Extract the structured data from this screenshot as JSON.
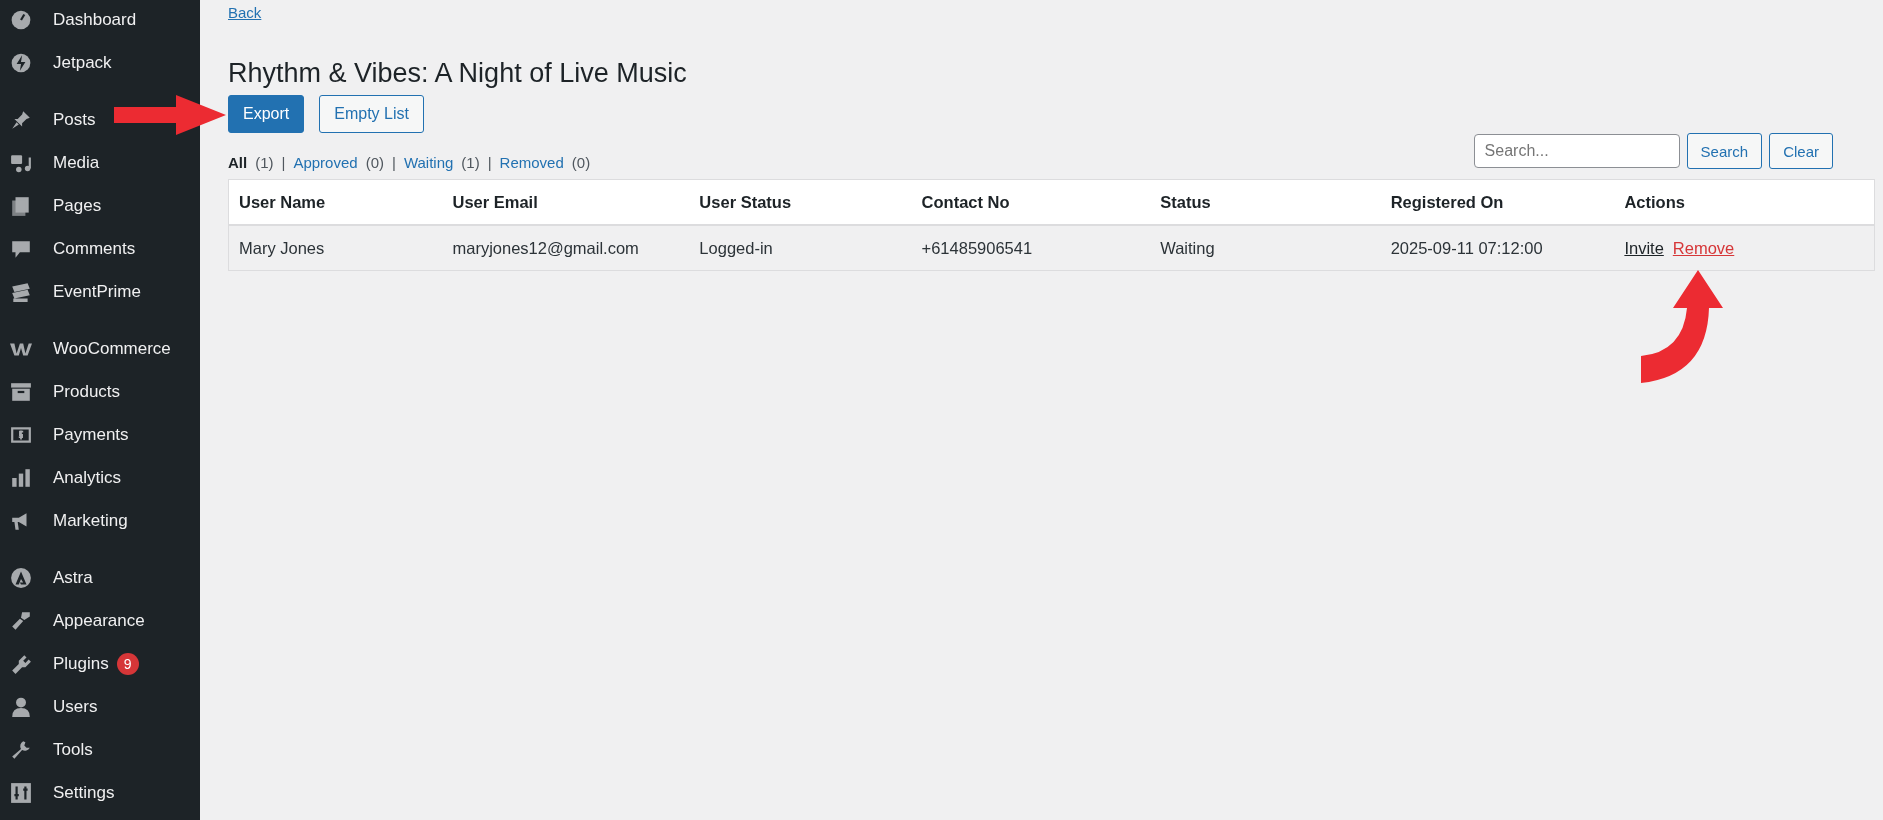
{
  "sidebar": {
    "groups": [
      [
        {
          "label": "Dashboard"
        },
        {
          "label": "Jetpack"
        }
      ],
      [
        {
          "label": "Posts"
        },
        {
          "label": "Media"
        },
        {
          "label": "Pages"
        },
        {
          "label": "Comments"
        },
        {
          "label": "EventPrime"
        }
      ],
      [
        {
          "label": "WooCommerce"
        },
        {
          "label": "Products"
        },
        {
          "label": "Payments"
        },
        {
          "label": "Analytics"
        },
        {
          "label": "Marketing"
        }
      ],
      [
        {
          "label": "Astra"
        },
        {
          "label": "Appearance"
        },
        {
          "label": "Plugins",
          "badge": "9"
        },
        {
          "label": "Users"
        },
        {
          "label": "Tools"
        },
        {
          "label": "Settings"
        }
      ]
    ]
  },
  "back_link": "Back",
  "title": "Rhythm & Vibes: A Night of Live Music",
  "buttons": [
    {
      "label": "Export",
      "kind": "primary"
    },
    {
      "label": "Empty List",
      "kind": "secondary"
    }
  ],
  "filter_separator": "|",
  "filters": [
    {
      "label": "All",
      "count": "(1)",
      "selected": true
    },
    {
      "label": "Approved",
      "count": "(0)",
      "selected": false
    },
    {
      "label": "Waiting",
      "count": "(1)",
      "selected": false
    },
    {
      "label": "Removed",
      "count": "(0)",
      "selected": false
    }
  ],
  "search": {
    "placeholder": "Search...",
    "buttons": [
      "Search",
      "Clear"
    ]
  },
  "table": {
    "columns": [
      "User Name",
      "User Email",
      "User Status",
      "Contact No",
      "Status",
      "Registered On",
      "Actions"
    ],
    "rows": [
      {
        "cells": [
          "Mary Jones",
          "maryjones12@gmail.com",
          "Logged-in",
          "+61485906541",
          "Waiting",
          "2025-09-11 07:12:00"
        ],
        "actions": [
          {
            "label": "Invite",
            "kind": "invite"
          },
          {
            "label": "Remove",
            "kind": "remove"
          }
        ]
      }
    ]
  }
}
